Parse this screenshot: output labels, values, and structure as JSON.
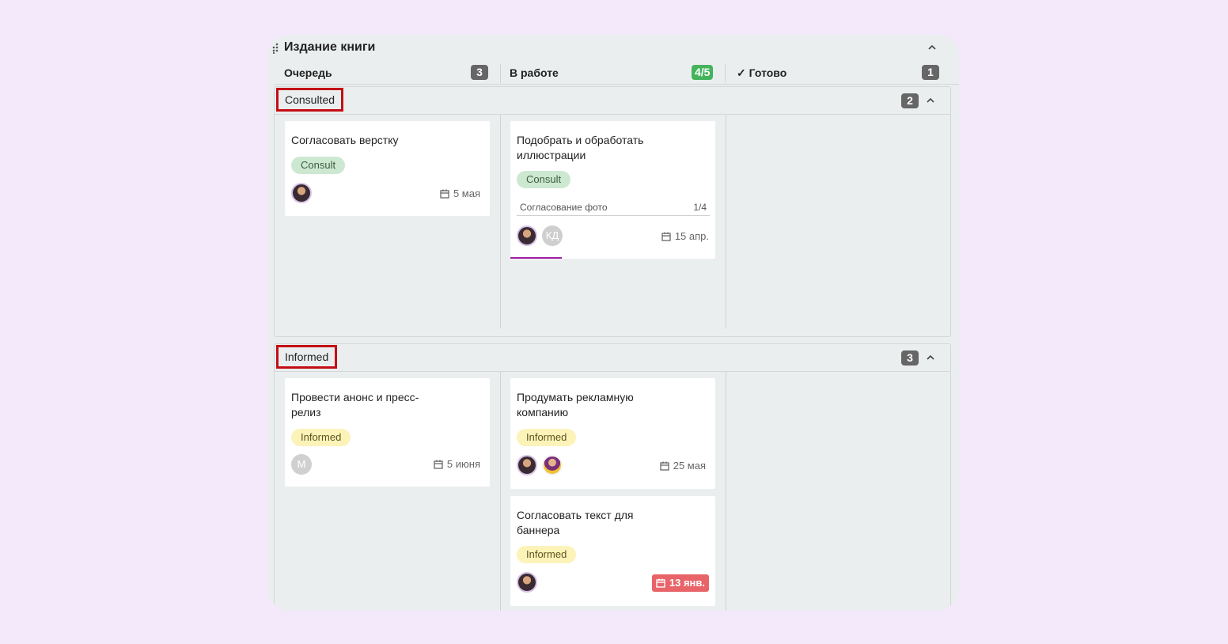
{
  "board": {
    "title": "Издание книги",
    "drag_icon": "drag-handle-icon",
    "collapse_icon": "chevron-up-icon"
  },
  "columns": [
    {
      "name": "Очередь",
      "count": "3",
      "check": ""
    },
    {
      "name": "В работе",
      "count": "4/5",
      "check": ""
    },
    {
      "name": "Готово",
      "count": "1",
      "check": "✓"
    }
  ],
  "groups": [
    {
      "label": "Consulted",
      "count": "2",
      "cards": [
        {
          "title": "Согласовать верстку",
          "tag": "Consult",
          "due": "5 мая"
        },
        {
          "title": "Подобрать и обработать иллюстрации",
          "tag": "Consult",
          "checklist_name": "Согласование фото",
          "checklist_count": "1/4",
          "avatar2": "КД",
          "due": "15 апр."
        }
      ]
    },
    {
      "label": "Informed",
      "count": "3",
      "cards": [
        {
          "title": "Провести анонс и пресс-релиз",
          "tag": "Informed",
          "avatar": "М",
          "due": "5 июня"
        },
        {
          "title": "Продумать рекламную компанию",
          "tag": "Informed",
          "due": "25 мая"
        },
        {
          "title": "Согласовать текст для баннера",
          "tag": "Informed",
          "due": "13 янв."
        }
      ]
    }
  ],
  "colors": {
    "page_bg": "#f3e9fb",
    "board_bg": "#ebeeee",
    "highlight_frame": "#c40e15",
    "badge_green": "#44b35b",
    "overdue": "#e86468",
    "progress": "#a21fa8"
  },
  "progress": {
    "card_checklist_fraction": 0.25
  }
}
